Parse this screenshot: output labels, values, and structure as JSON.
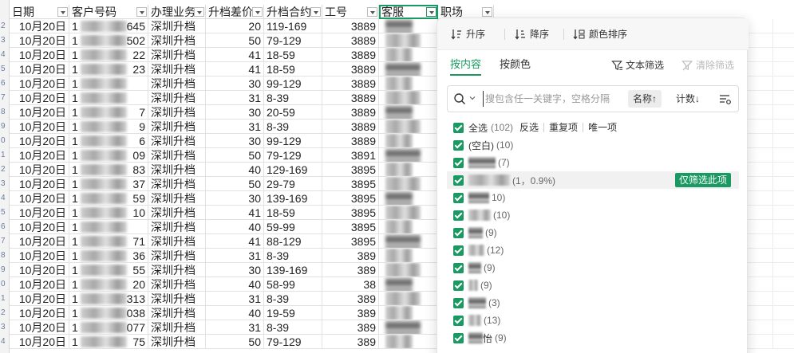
{
  "colors": {
    "accent": "#1a9a62"
  },
  "sheet": {
    "row_numbers": [
      "2",
      "3",
      "4",
      "5",
      "6",
      "7",
      "8",
      "9",
      "0",
      "1",
      "2",
      "3",
      "4",
      "5",
      "6",
      "7",
      "8",
      "9",
      "0",
      "1",
      "2",
      "3",
      "4"
    ],
    "headers": [
      "日期",
      "客户号码",
      "办理业务",
      "升档差价",
      "升档合约",
      "工号",
      "客服",
      "职场"
    ],
    "rows": [
      {
        "date": "10月20日",
        "phone_end": "645",
        "biz": "深圳升档",
        "diff": "20",
        "plan": "119-169",
        "id": "3889"
      },
      {
        "date": "10月20日",
        "phone_end": "502",
        "biz": "深圳升档",
        "diff": "50",
        "plan": "79-129",
        "id": "3889"
      },
      {
        "date": "10月20日",
        "phone_end": "22",
        "biz": "深圳升档",
        "diff": "41",
        "plan": "18-59",
        "id": "3889"
      },
      {
        "date": "10月20日",
        "phone_end": "23",
        "biz": "深圳升档",
        "diff": "41",
        "plan": "18-59",
        "id": "3889"
      },
      {
        "date": "10月20日",
        "phone_end": "",
        "biz": "深圳升档",
        "diff": "30",
        "plan": "99-129",
        "id": "3889"
      },
      {
        "date": "10月20日",
        "phone_end": "",
        "biz": "深圳升档",
        "diff": "31",
        "plan": "8-39",
        "id": "3889"
      },
      {
        "date": "10月20日",
        "phone_end": "7",
        "biz": "深圳升档",
        "diff": "30",
        "plan": "20-59",
        "id": "3889"
      },
      {
        "date": "10月20日",
        "phone_end": "9",
        "biz": "深圳升档",
        "diff": "31",
        "plan": "8-39",
        "id": "3889"
      },
      {
        "date": "10月20日",
        "phone_end": "6",
        "biz": "深圳升档",
        "diff": "30",
        "plan": "99-129",
        "id": "3889"
      },
      {
        "date": "10月20日",
        "phone_end": "09",
        "biz": "深圳升档",
        "diff": "50",
        "plan": "79-129",
        "id": "3891"
      },
      {
        "date": "10月20日",
        "phone_end": "83",
        "biz": "深圳升档",
        "diff": "40",
        "plan": "129-169",
        "id": "3895"
      },
      {
        "date": "10月20日",
        "phone_end": "37",
        "biz": "深圳升档",
        "diff": "50",
        "plan": "29-79",
        "id": "3895"
      },
      {
        "date": "10月20日",
        "phone_end": "59",
        "biz": "深圳升档",
        "diff": "30",
        "plan": "139-169",
        "id": "3895"
      },
      {
        "date": "10月20日",
        "phone_end": "10",
        "biz": "深圳升档",
        "diff": "41",
        "plan": "18-59",
        "id": "3895"
      },
      {
        "date": "10月20日",
        "phone_end": "",
        "biz": "深圳升档",
        "diff": "40",
        "plan": "59-99",
        "id": "3895"
      },
      {
        "date": "10月20日",
        "phone_end": "71",
        "biz": "深圳升档",
        "diff": "41",
        "plan": "88-129",
        "id": "3895"
      },
      {
        "date": "10月20日",
        "phone_end": "36",
        "biz": "深圳升档",
        "diff": "31",
        "plan": "8-39",
        "id": "389"
      },
      {
        "date": "10月20日",
        "phone_end": "55",
        "biz": "深圳升档",
        "diff": "30",
        "plan": "139-169",
        "id": "389"
      },
      {
        "date": "10月20日",
        "phone_end": "20",
        "biz": "深圳升档",
        "diff": "40",
        "plan": "58-99",
        "id": "38"
      },
      {
        "date": "10月20日",
        "phone_end": "313",
        "biz": "深圳升档",
        "diff": "31",
        "plan": "8-39",
        "id": "389"
      },
      {
        "date": "10月20日",
        "phone_end": "038",
        "biz": "深圳升档",
        "diff": "40",
        "plan": "19-59",
        "id": "389"
      },
      {
        "date": "10月20日",
        "phone_end": "077",
        "biz": "深圳升档",
        "diff": "31",
        "plan": "8-39",
        "id": "389"
      },
      {
        "date": "10月20日",
        "phone_end": "75",
        "biz": "深圳升档",
        "diff": "50",
        "plan": "79-129",
        "id": "389"
      }
    ]
  },
  "popup": {
    "sort": {
      "asc": "升序",
      "desc": "降序",
      "color": "颜色排序"
    },
    "tabs": {
      "by_content": "按内容",
      "by_color": "按颜色"
    },
    "tools": {
      "text_filter": "文本筛选",
      "clear_filter": "清除筛选"
    },
    "search": {
      "placeholder": "搜包含任一关键字，空格分隔",
      "sort_name": "名称↑",
      "sort_count": "计数↓"
    },
    "select_all": {
      "label": "全选",
      "count": "(102)"
    },
    "actions": [
      "反选",
      "重复项",
      "唯一项"
    ],
    "items": [
      {
        "label": "(空白)",
        "count": "(10)"
      },
      {
        "label": "",
        "count": "(7)"
      },
      {
        "label": "",
        "count": "(1，0.9%)"
      },
      {
        "label": "",
        "count": "10)"
      },
      {
        "label": "",
        "count": "(10)"
      },
      {
        "label": "",
        "count": "(9)"
      },
      {
        "label": "",
        "count": "(12)"
      },
      {
        "label": "",
        "count": "(9)"
      },
      {
        "label": "",
        "count": "(9)"
      },
      {
        "label": "",
        "count": "(3)"
      },
      {
        "label": "",
        "count": "(13)"
      },
      {
        "label": "怡",
        "count": "(9)"
      }
    ],
    "only_this": "仅筛选此项"
  }
}
